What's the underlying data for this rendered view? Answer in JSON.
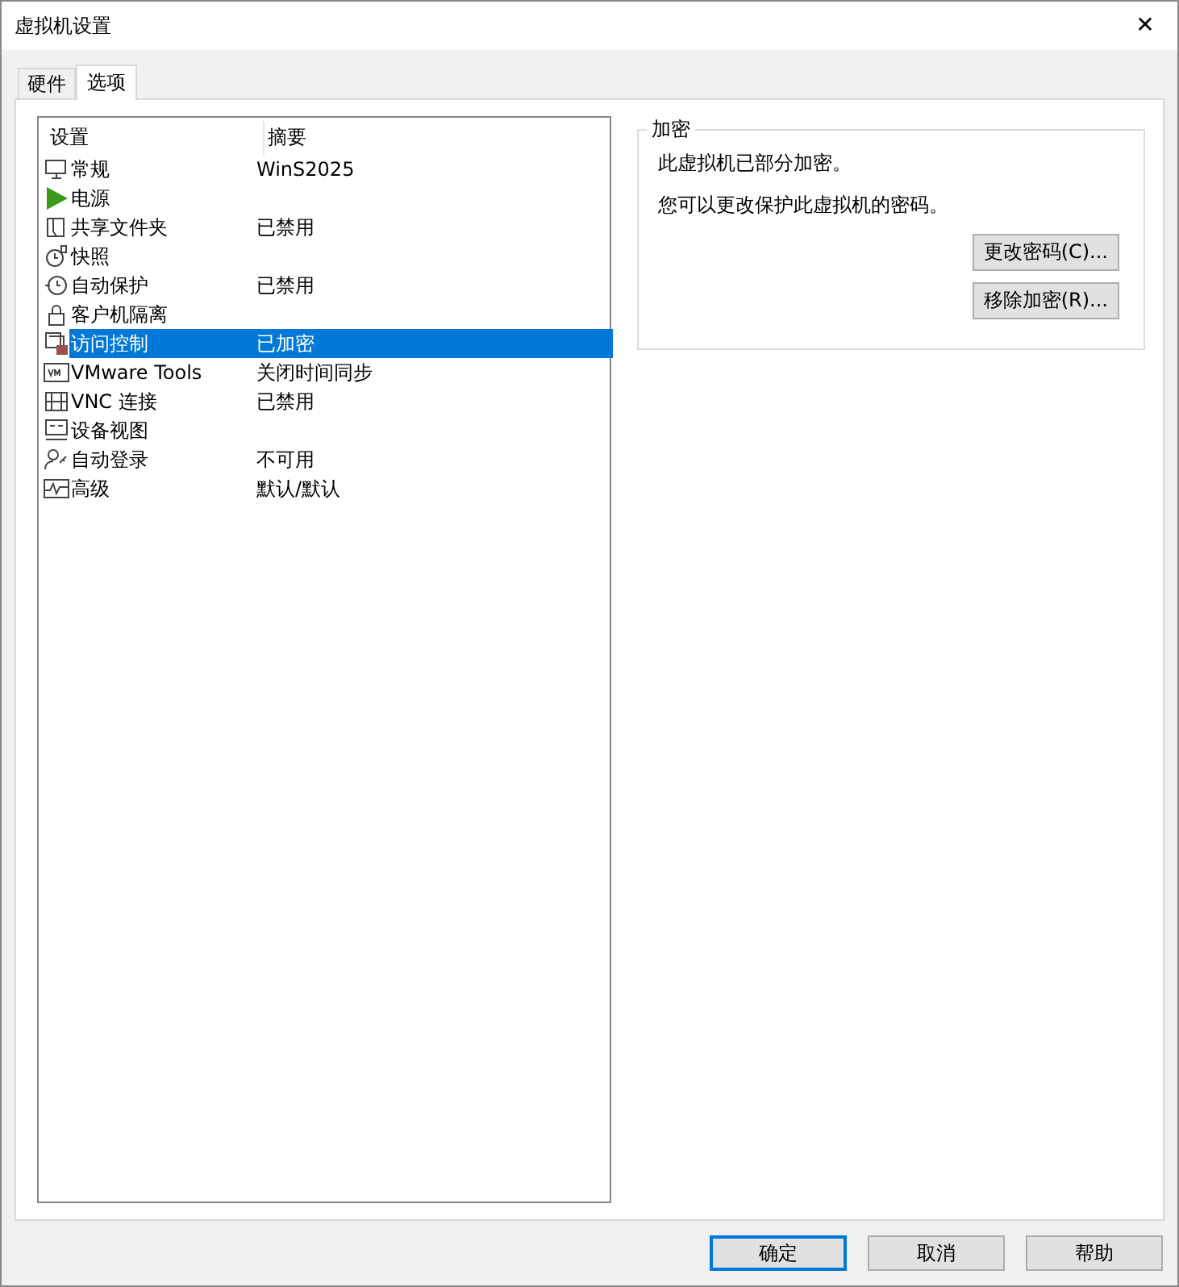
{
  "window": {
    "title": "虚拟机设置",
    "close": "✕"
  },
  "tabs": [
    {
      "label": "硬件",
      "selected": false
    },
    {
      "label": "选项",
      "selected": true
    }
  ],
  "settings_list": {
    "columns": [
      "设置",
      "摘要"
    ],
    "rows": [
      {
        "name": "常规",
        "summary": "WinS2025",
        "selected": false
      },
      {
        "name": "电源",
        "selected": false
      },
      {
        "name": "共享文件夹",
        "summary": "已禁用",
        "selected": false
      },
      {
        "name": "快照",
        "selected": false
      },
      {
        "name": "自动保护",
        "summary": "已禁用",
        "selected": false
      },
      {
        "name": "客户机隔离",
        "selected": false
      },
      {
        "name": "访问控制",
        "summary": "已加密",
        "selected": true
      },
      {
        "name": "VMware Tools",
        "summary": "关闭时间同步",
        "selected": false
      },
      {
        "name": "VNC 连接",
        "summary": "已禁用",
        "selected": false
      },
      {
        "name": "设备视图",
        "selected": false
      },
      {
        "name": "自动登录",
        "summary": "不可用",
        "selected": false
      },
      {
        "name": "高级",
        "summary": "默认/默认",
        "selected": false
      }
    ]
  },
  "encryption": {
    "title": "加密",
    "status": "此虚拟机已部分加密。",
    "hint": "您可以更改保护此虚拟机的密码。",
    "buttons": [
      "更改密码(C)...",
      "移除加密(R)..."
    ]
  },
  "buttons": [
    {
      "label": "确定",
      "default": true
    },
    {
      "label": "取消",
      "default": false
    },
    {
      "label": "帮助",
      "default": false
    }
  ]
}
